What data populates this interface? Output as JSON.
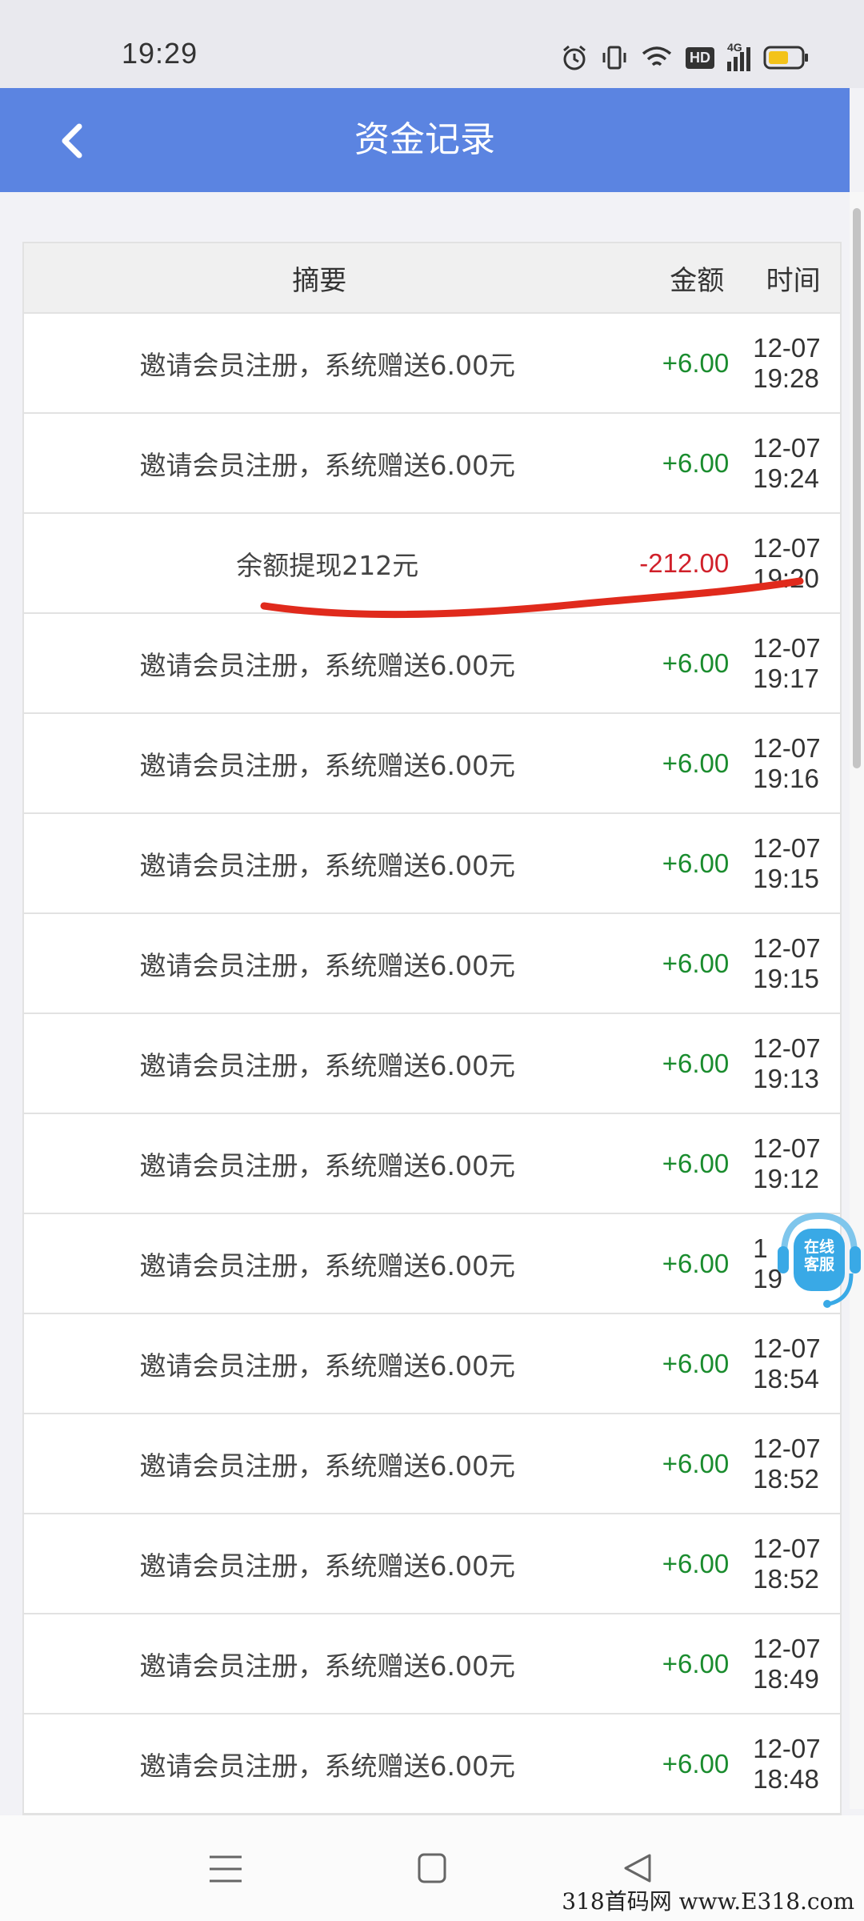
{
  "status_bar": {
    "time": "19:29",
    "icons": [
      "alarm-icon",
      "vibrate-icon",
      "wifi-icon",
      "hd-icon",
      "signal-4g-icon",
      "battery-icon"
    ],
    "hd_label": "HD",
    "network_label": "4G"
  },
  "header": {
    "title": "资金记录",
    "back_icon": "chevron-left-icon",
    "background": "#5b84e1"
  },
  "table": {
    "columns": {
      "summary": "摘要",
      "amount": "金额",
      "time": "时间"
    },
    "rows": [
      {
        "summary": "邀请会员注册，系统赠送6.00元",
        "amount": "+6.00",
        "date": "12-07",
        "time": "19:28"
      },
      {
        "summary": "邀请会员注册，系统赠送6.00元",
        "amount": "+6.00",
        "date": "12-07",
        "time": "19:24"
      },
      {
        "summary": "余额提现212元",
        "amount": "-212.00",
        "date": "12-07",
        "time": "19:20"
      },
      {
        "summary": "邀请会员注册，系统赠送6.00元",
        "amount": "+6.00",
        "date": "12-07",
        "time": "19:17"
      },
      {
        "summary": "邀请会员注册，系统赠送6.00元",
        "amount": "+6.00",
        "date": "12-07",
        "time": "19:16"
      },
      {
        "summary": "邀请会员注册，系统赠送6.00元",
        "amount": "+6.00",
        "date": "12-07",
        "time": "19:15"
      },
      {
        "summary": "邀请会员注册，系统赠送6.00元",
        "amount": "+6.00",
        "date": "12-07",
        "time": "19:15"
      },
      {
        "summary": "邀请会员注册，系统赠送6.00元",
        "amount": "+6.00",
        "date": "12-07",
        "time": "19:13"
      },
      {
        "summary": "邀请会员注册，系统赠送6.00元",
        "amount": "+6.00",
        "date": "12-07",
        "time": "19:12"
      },
      {
        "summary": "邀请会员注册，系统赠送6.00元",
        "amount": "+6.00",
        "date": "1",
        "time": "19"
      },
      {
        "summary": "邀请会员注册，系统赠送6.00元",
        "amount": "+6.00",
        "date": "12-07",
        "time": "18:54"
      },
      {
        "summary": "邀请会员注册，系统赠送6.00元",
        "amount": "+6.00",
        "date": "12-07",
        "time": "18:52"
      },
      {
        "summary": "邀请会员注册，系统赠送6.00元",
        "amount": "+6.00",
        "date": "12-07",
        "time": "18:52"
      },
      {
        "summary": "邀请会员注册，系统赠送6.00元",
        "amount": "+6.00",
        "date": "12-07",
        "time": "18:49"
      },
      {
        "summary": "邀请会员注册，系统赠送6.00元",
        "amount": "+6.00",
        "date": "12-07",
        "time": "18:48"
      }
    ],
    "positive_color": "#1a8c2e",
    "negative_color": "#d0202a"
  },
  "floating_service": {
    "label_line1": "在线",
    "label_line2": "客服",
    "icon": "headset-icon"
  },
  "nav_bar": {
    "icons": [
      "menu-icon",
      "home-square-icon",
      "back-triangle-icon"
    ]
  },
  "watermark": "318首码网 www.E318.com"
}
